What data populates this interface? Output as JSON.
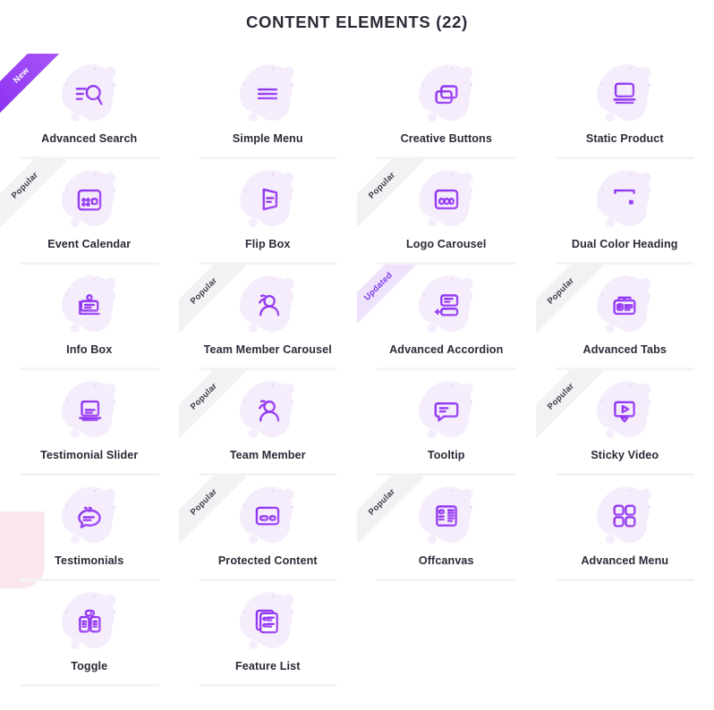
{
  "header": {
    "title": "CONTENT ELEMENTS (22)"
  },
  "theme": {
    "accent_start": "#8b2ff0",
    "accent_end": "#a855f7",
    "blob_fill": "#f5edfb",
    "title_color": "#2b2b38",
    "divider_color": "#f4f4f6",
    "ribbon_new_bg": "#8b2ff0",
    "ribbon_popular_bg": "#f2f2f4",
    "ribbon_updated_bg": "#efe2fb",
    "deco_pink": "#fbe8ee"
  },
  "badges": {
    "new": "New",
    "popular": "Popular",
    "updated": "Updated"
  },
  "elements": [
    {
      "label": "Advanced Search",
      "icon": "magnifier-lines-icon",
      "badge": "New"
    },
    {
      "label": "Simple Menu",
      "icon": "hamburger-menu-icon",
      "badge": ""
    },
    {
      "label": "Creative Buttons",
      "icon": "stacked-buttons-icon",
      "badge": ""
    },
    {
      "label": "Static Product",
      "icon": "monitor-product-icon",
      "badge": ""
    },
    {
      "label": "Event Calendar",
      "icon": "calendar-icon",
      "badge": "Popular"
    },
    {
      "label": "Flip Box",
      "icon": "flip-card-icon",
      "badge": ""
    },
    {
      "label": "Logo Carousel",
      "icon": "logo-carousel-icon",
      "badge": "Popular"
    },
    {
      "label": "Dual Color Heading",
      "icon": "text-heading-t-icon",
      "badge": ""
    },
    {
      "label": "Info Box",
      "icon": "info-card-icon",
      "badge": ""
    },
    {
      "label": "Team Member Carousel",
      "icon": "person-avatar-icon",
      "badge": "Popular"
    },
    {
      "label": "Advanced Accordion",
      "icon": "accordion-panels-icon",
      "badge": "Updated"
    },
    {
      "label": "Advanced Tabs",
      "icon": "tabs-panel-icon",
      "badge": "Popular"
    },
    {
      "label": "Testimonial Slider",
      "icon": "quote-slide-icon",
      "badge": ""
    },
    {
      "label": "Team Member",
      "icon": "person-avatar-icon",
      "badge": "Popular"
    },
    {
      "label": "Tooltip",
      "icon": "speech-bubble-icon",
      "badge": ""
    },
    {
      "label": "Sticky Video",
      "icon": "video-play-icon",
      "badge": "Popular"
    },
    {
      "label": "Testimonials",
      "icon": "quote-bubble-icon",
      "badge": ""
    },
    {
      "label": "Protected Content",
      "icon": "card-protected-icon",
      "badge": "Popular"
    },
    {
      "label": "Offcanvas",
      "icon": "offcanvas-panel-icon",
      "badge": "Popular"
    },
    {
      "label": "Advanced Menu",
      "icon": "grid-four-squares-icon",
      "badge": ""
    },
    {
      "label": "Toggle",
      "icon": "toggle-switch-icon",
      "badge": ""
    },
    {
      "label": "Feature List",
      "icon": "feature-list-icon",
      "badge": ""
    }
  ]
}
